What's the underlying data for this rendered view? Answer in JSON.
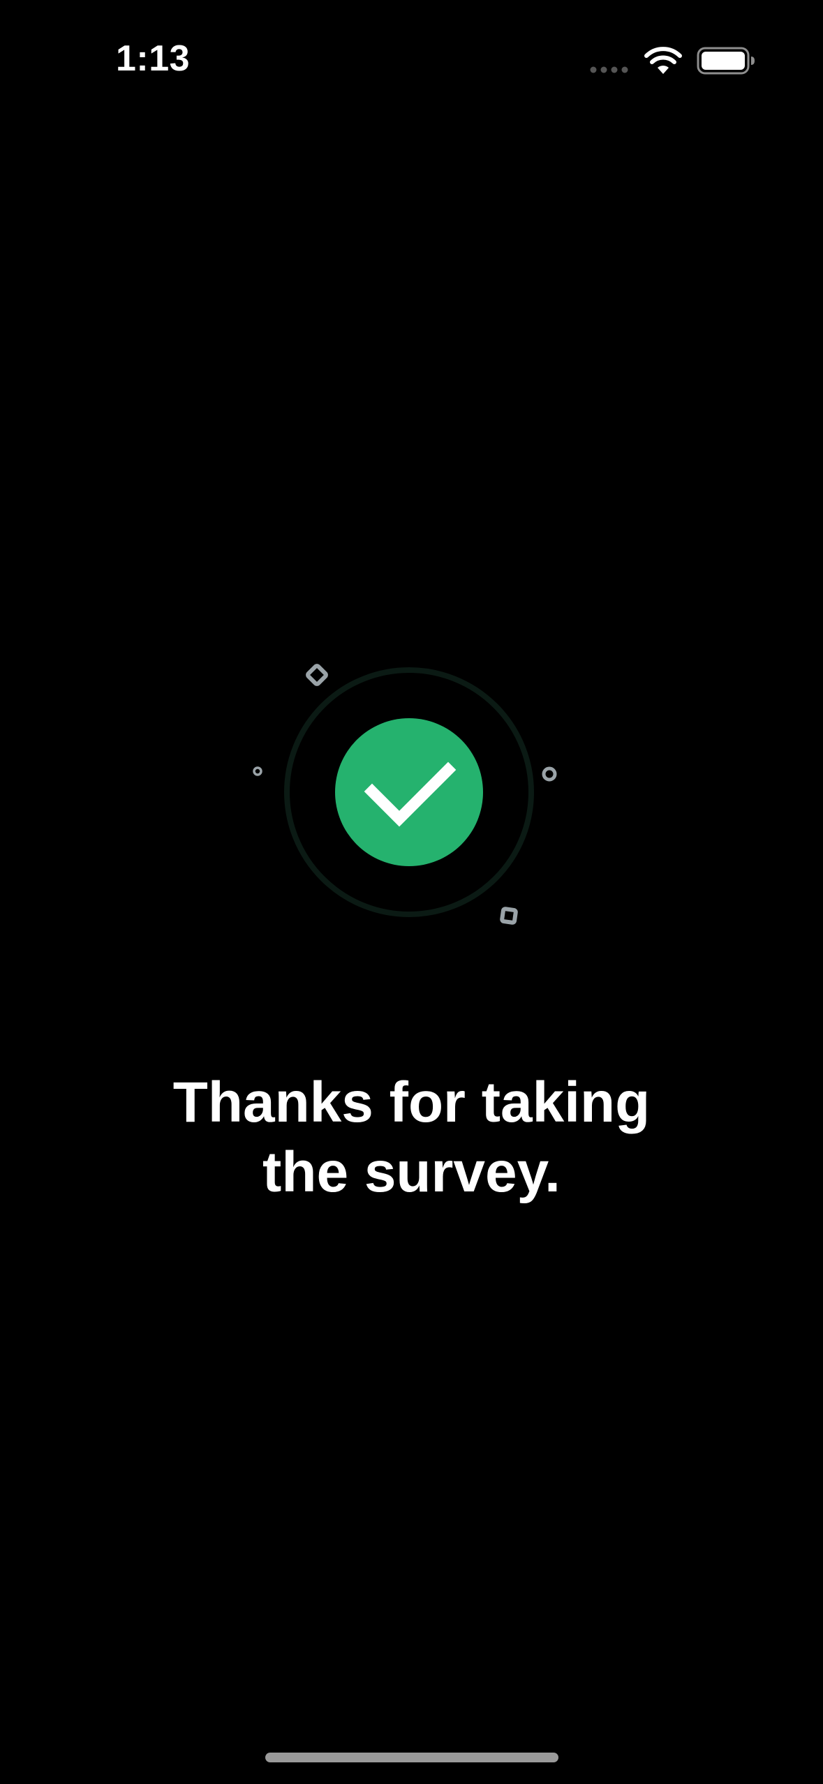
{
  "status_bar": {
    "time": "1:13",
    "icons": [
      "cellular-signal-icon",
      "wifi-icon",
      "battery-icon"
    ]
  },
  "success": {
    "icon": "checkmark-icon",
    "accent_color": "#25B26E",
    "ring_color": "#0B1A14",
    "confetti_color": "#9AA3A8"
  },
  "message": {
    "line1": "Thanks for taking",
    "line2": "the survey."
  }
}
